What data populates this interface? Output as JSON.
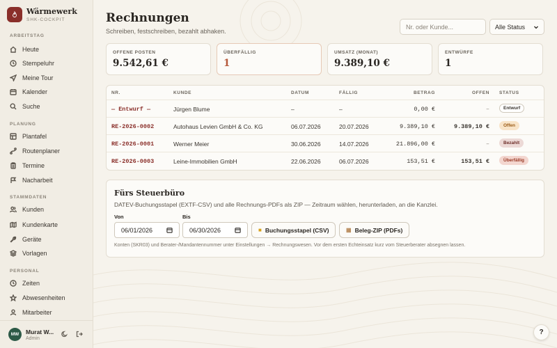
{
  "brand": {
    "name": "Wärmewerk",
    "subtitle": "SHK-COCKPIT"
  },
  "sidebar": {
    "sections": [
      {
        "label": "ARBEITSTAG",
        "items": [
          {
            "label": "Heute",
            "icon": "home-icon"
          },
          {
            "label": "Stempeluhr",
            "icon": "clock-icon"
          },
          {
            "label": "Meine Tour",
            "icon": "navigation-icon"
          },
          {
            "label": "Kalender",
            "icon": "calendar-icon"
          },
          {
            "label": "Suche",
            "icon": "search-icon"
          }
        ]
      },
      {
        "label": "PLANUNG",
        "items": [
          {
            "label": "Plantafel",
            "icon": "grid-icon"
          },
          {
            "label": "Routenplaner",
            "icon": "route-icon"
          },
          {
            "label": "Termine",
            "icon": "clipboard-icon"
          },
          {
            "label": "Nacharbeit",
            "icon": "flag-icon"
          }
        ]
      },
      {
        "label": "STAMMDATEN",
        "items": [
          {
            "label": "Kunden",
            "icon": "users-icon"
          },
          {
            "label": "Kundenkarte",
            "icon": "map-icon"
          },
          {
            "label": "Geräte",
            "icon": "wrench-icon"
          },
          {
            "label": "Vorlagen",
            "icon": "layers-icon"
          }
        ]
      },
      {
        "label": "PERSONAL",
        "items": [
          {
            "label": "Zeiten",
            "icon": "clock-icon"
          },
          {
            "label": "Abwesenheiten",
            "icon": "star-icon"
          },
          {
            "label": "Mitarbeiter",
            "icon": "user-icon"
          }
        ]
      }
    ]
  },
  "user": {
    "initials": "MW",
    "name": "Murat W...",
    "role": "Admin"
  },
  "header": {
    "title": "Rechnungen",
    "subtitle": "Schreiben, festschreiben, bezahlt abhaken.",
    "search_placeholder": "Nr. oder Kunde...",
    "status_filter": "Alle Status"
  },
  "stats": [
    {
      "label": "OFFENE POSTEN",
      "value": "9.542,61 €"
    },
    {
      "label": "ÜBERFÄLLIG",
      "value": "1"
    },
    {
      "label": "UMSATZ (MONAT)",
      "value": "9.389,10 €"
    },
    {
      "label": "ENTWÜRFE",
      "value": "1"
    }
  ],
  "table": {
    "columns": [
      "NR.",
      "KUNDE",
      "DATUM",
      "FÄLLIG",
      "BETRAG",
      "OFFEN",
      "STATUS"
    ],
    "rows": [
      {
        "nr": "— Entwurf —",
        "kunde": "Jürgen Blume",
        "datum": "–",
        "faellig": "–",
        "betrag": "0,00 €",
        "offen": "–",
        "status": "Entwurf"
      },
      {
        "nr": "RE-2026-0002",
        "kunde": "Autohaus Levien GmbH & Co. KG",
        "datum": "06.07.2026",
        "faellig": "20.07.2026",
        "betrag": "9.389,10 €",
        "offen": "9.389,10 €",
        "status": "Offen"
      },
      {
        "nr": "RE-2026-0001",
        "kunde": "Werner Meier",
        "datum": "30.06.2026",
        "faellig": "14.07.2026",
        "betrag": "21.896,00 €",
        "offen": "–",
        "status": "Bezahlt"
      },
      {
        "nr": "RE-2026-0003",
        "kunde": "Leine-Immobilien GmbH",
        "datum": "22.06.2026",
        "faellig": "06.07.2026",
        "betrag": "153,51 €",
        "offen": "153,51 €",
        "status": "Überfällig"
      }
    ],
    "status_colors": {
      "Entwurf": {
        "bg": "#ffffff",
        "fg": "#3a352f",
        "border": "#cfc8bb"
      },
      "Offen": {
        "bg": "#f8e4c8",
        "fg": "#9a5a14",
        "border": "#f8e4c8"
      },
      "Bezahlt": {
        "bg": "#ecd9d6",
        "fg": "#6e2f2a",
        "border": "#ecd9d6"
      },
      "Überfällig": {
        "bg": "#f3d6cf",
        "fg": "#9a3a26",
        "border": "#f3d6cf"
      }
    }
  },
  "export_panel": {
    "title": "Fürs Steuerbüro",
    "description": "DATEV-Buchungsstapel (EXTF-CSV) und alle Rechnungs-PDFs als ZIP — Zeitraum wählen, herunterladen, an die Kanzlei.",
    "from_label": "Von",
    "from_value": "06/01/2026",
    "to_label": "Bis",
    "to_value": "06/30/2026",
    "btn_csv": "Buchungsstapel (CSV)",
    "btn_zip": "Beleg-ZIP (PDFs)",
    "note": "Konten (SKR03) und Berater-/Mandantennummer unter Einstellungen → Rechnungswesen. Vor dem ersten Echteinsatz kurz vom Steuerberater absegnen lassen."
  },
  "help_label": "?",
  "colors": {
    "accent": "#8a2f2a",
    "avatar": "#2d5a47",
    "background": "#f6f3ec"
  }
}
